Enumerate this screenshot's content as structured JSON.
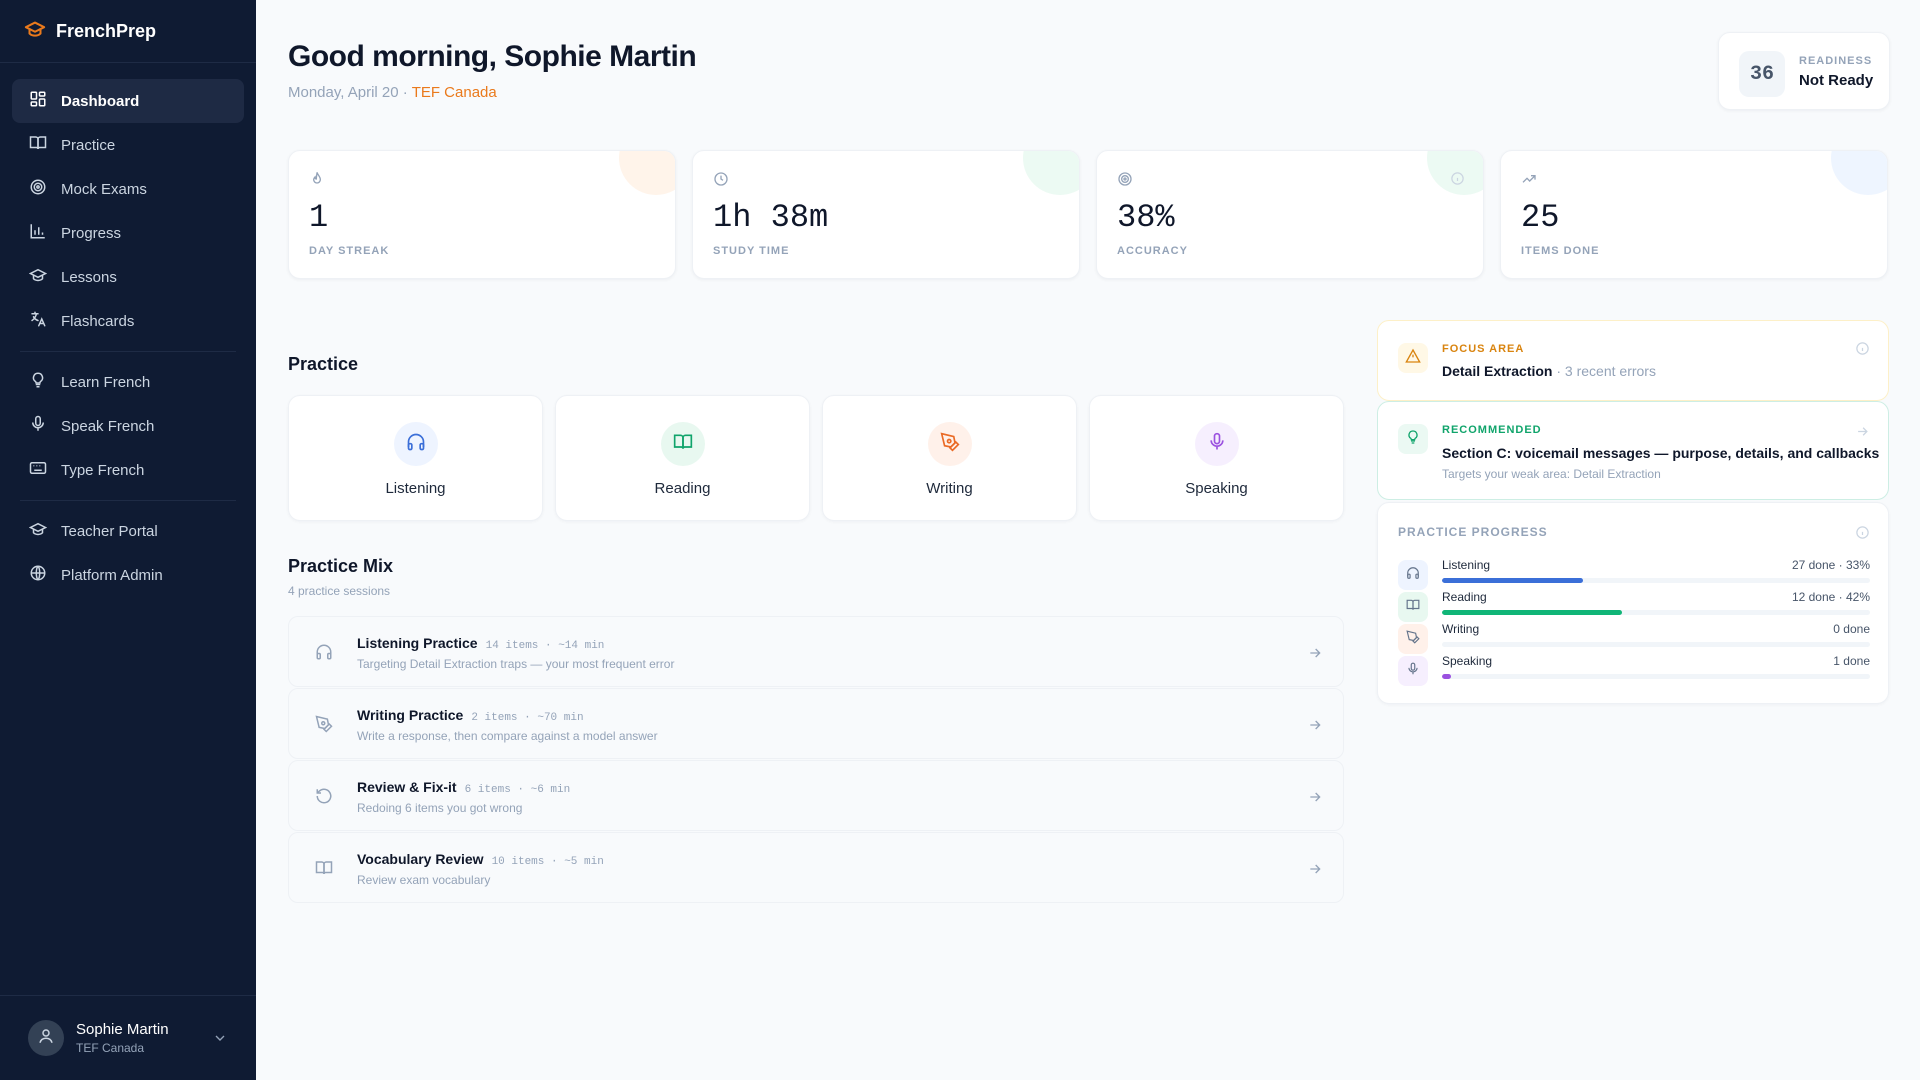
{
  "brand": {
    "name": "FrenchPrep",
    "accent": "#ea7a1c"
  },
  "nav": {
    "primary": [
      {
        "label": "Dashboard",
        "icon": "dashboard-icon",
        "active": true
      },
      {
        "label": "Practice",
        "icon": "book-icon"
      },
      {
        "label": "Mock Exams",
        "icon": "target-icon"
      },
      {
        "label": "Progress",
        "icon": "bar-chart-icon"
      },
      {
        "label": "Lessons",
        "icon": "graduation-cap-icon"
      },
      {
        "label": "Flashcards",
        "icon": "translate-icon"
      }
    ],
    "learn": [
      {
        "label": "Learn French",
        "icon": "lightbulb-icon"
      },
      {
        "label": "Speak French",
        "icon": "microphone-icon"
      },
      {
        "label": "Type French",
        "icon": "keyboard-icon"
      }
    ],
    "admin": [
      {
        "label": "Teacher Portal",
        "icon": "graduation-cap-icon"
      },
      {
        "label": "Platform Admin",
        "icon": "globe-icon"
      }
    ]
  },
  "user": {
    "name": "Sophie Martin",
    "exam": "TEF Canada"
  },
  "header": {
    "greeting": "Good morning, Sophie Martin",
    "date": "Monday, April 20 ·",
    "exam": "TEF Canada"
  },
  "readiness": {
    "score": "36",
    "label": "READINESS",
    "status": "Not Ready"
  },
  "stats": [
    {
      "value": "1",
      "label": "DAY STREAK",
      "icon": "flame-icon",
      "blob": "#fff4ea"
    },
    {
      "value": "1h 38m",
      "label": "STUDY TIME",
      "icon": "clock-icon",
      "blob": "#ecfaf3"
    },
    {
      "value": "38%",
      "label": "ACCURACY",
      "icon": "target-icon",
      "blob": "#ecfaf3"
    },
    {
      "value": "25",
      "label": "ITEMS DONE",
      "icon": "trending-up-icon",
      "blob": "#eef5ff"
    }
  ],
  "practice": {
    "title": "Practice",
    "skills": [
      {
        "label": "Listening",
        "icon": "headphones-icon",
        "bg": "#eef4ff",
        "color": "#3b6fd8"
      },
      {
        "label": "Reading",
        "icon": "book-open-icon",
        "bg": "#e8f8f0",
        "color": "#10a46b"
      },
      {
        "label": "Writing",
        "icon": "pen-icon",
        "bg": "#fff1ea",
        "color": "#ea6a25"
      },
      {
        "label": "Speaking",
        "icon": "microphone-icon",
        "bg": "#f6effe",
        "color": "#9b51e0"
      }
    ]
  },
  "mix": {
    "title": "Practice Mix",
    "subtitle": "4 practice sessions",
    "rows": [
      {
        "title": "Listening Practice",
        "meta": "14 items · ~14 min",
        "desc": "Targeting Detail Extraction traps — your most frequent error",
        "icon": "headphones-icon"
      },
      {
        "title": "Writing Practice",
        "meta": "2 items · ~70 min",
        "desc": "Write a response, then compare against a model answer",
        "icon": "pen-icon"
      },
      {
        "title": "Review & Fix-it",
        "meta": "6 items · ~6 min",
        "desc": "Redoing 6 items you got wrong",
        "icon": "rotate-icon"
      },
      {
        "title": "Vocabulary Review",
        "meta": "10 items · ~5 min",
        "desc": "Review exam vocabulary",
        "icon": "book-open-icon"
      }
    ]
  },
  "focus": {
    "kicker": "FOCUS AREA",
    "area": "Detail Extraction",
    "detail": "· 3 recent errors",
    "color": "#d9840f"
  },
  "recommended": {
    "kicker": "RECOMMENDED",
    "title": "Section C: voicemail messages — purpose, details, and callbacks",
    "subtitle": "Targets your weak area: Detail Extraction",
    "color": "#10a46b"
  },
  "progress": {
    "title": "PRACTICE PROGRESS",
    "rows": [
      {
        "label": "Listening",
        "stat": "27 done · 33%",
        "fraction": 0.33,
        "color": "#3b6fd8",
        "icon": "headphones-icon",
        "bg": "#eef4ff"
      },
      {
        "label": "Reading",
        "stat": "12 done · 42%",
        "fraction": 0.42,
        "color": "#10b577",
        "icon": "book-open-icon",
        "bg": "#e8f8f0"
      },
      {
        "label": "Writing",
        "stat": "0 done",
        "fraction": 0,
        "color": "#ea6a25",
        "icon": "pen-icon",
        "bg": "#fff1ea"
      },
      {
        "label": "Speaking",
        "stat": "1 done",
        "fraction": 0.02,
        "color": "#9b51e0",
        "icon": "microphone-icon",
        "bg": "#f6effe"
      }
    ]
  }
}
